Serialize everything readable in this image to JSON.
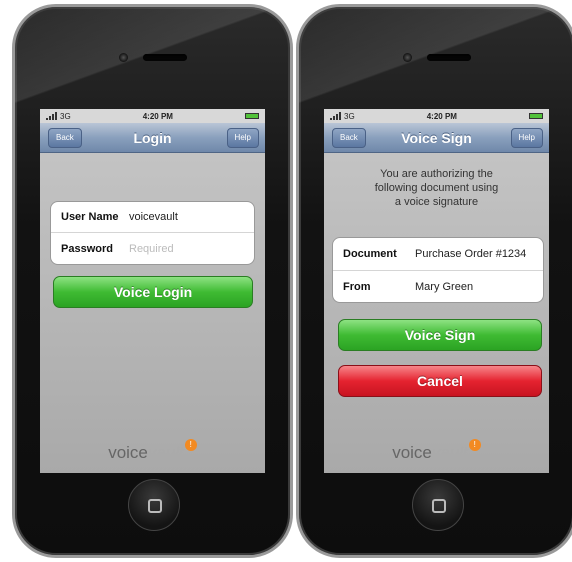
{
  "left_phone": {
    "status": {
      "carrier": "3G",
      "time": "4:20 PM"
    },
    "nav": {
      "back": "Back",
      "title": "Login",
      "help": "Help"
    },
    "form": {
      "username_label": "User Name",
      "username_value": "voicevault",
      "password_label": "Password",
      "password_placeholder": "Required"
    },
    "login_button": "Voice Login",
    "logo": {
      "dark": "voice",
      "light": "vault"
    }
  },
  "right_phone": {
    "status": {
      "carrier": "3G",
      "time": "4:20 PM"
    },
    "nav": {
      "back": "Back",
      "title": "Voice Sign",
      "help": "Help"
    },
    "intro": {
      "line1": "You are authorizing the",
      "line2": "following document using",
      "line3": "a voice signature"
    },
    "details": {
      "document_label": "Document",
      "document_value": "Purchase Order #1234",
      "from_label": "From",
      "from_value": "Mary Green"
    },
    "sign_button": "Voice Sign",
    "cancel_button": "Cancel",
    "logo": {
      "dark": "voice",
      "light": "vault"
    }
  },
  "icons": [
    "signal-icon",
    "battery-icon",
    "home-button-icon",
    "logo-badge-icon"
  ],
  "colors": {
    "green": "#3fbb33",
    "red": "#e52330",
    "nav": "#6f88aa",
    "logo_badge": "#f28a22"
  }
}
